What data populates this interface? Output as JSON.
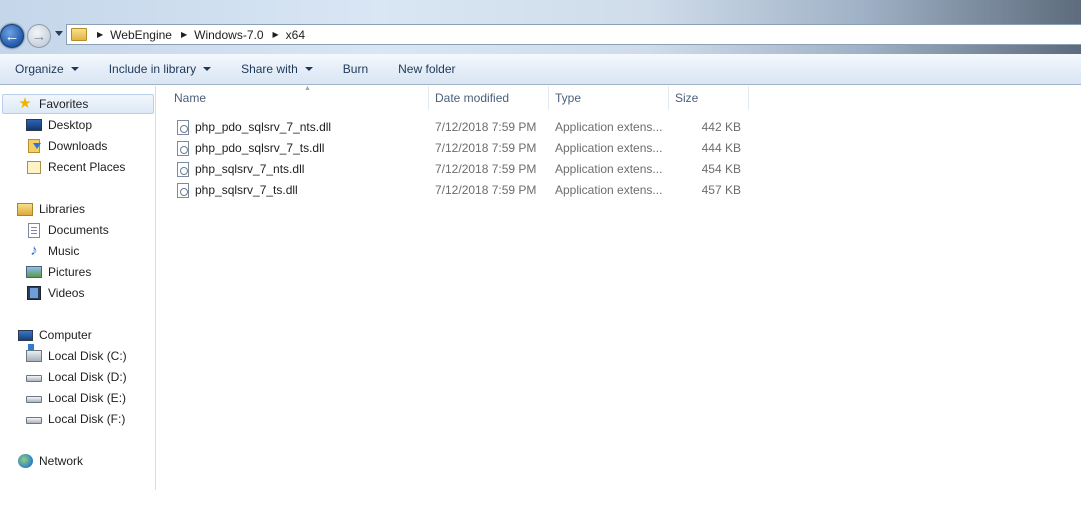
{
  "address": {
    "breadcrumbs": [
      "WebEngine",
      "Windows-7.0",
      "x64"
    ]
  },
  "toolbar": {
    "organize": "Organize",
    "include_in_library": "Include in library",
    "share_with": "Share with",
    "burn": "Burn",
    "new_folder": "New folder"
  },
  "sidebar": {
    "favorites": {
      "label": "Favorites",
      "items": [
        "Desktop",
        "Downloads",
        "Recent Places"
      ]
    },
    "libraries": {
      "label": "Libraries",
      "items": [
        "Documents",
        "Music",
        "Pictures",
        "Videos"
      ]
    },
    "computer": {
      "label": "Computer",
      "items": [
        "Local Disk (C:)",
        "Local Disk (D:)",
        "Local Disk (E:)",
        "Local Disk (F:)"
      ]
    },
    "network": {
      "label": "Network"
    }
  },
  "columns": {
    "name": "Name",
    "date_modified": "Date modified",
    "type": "Type",
    "size": "Size"
  },
  "files": [
    {
      "name": "php_pdo_sqlsrv_7_nts.dll",
      "date": "7/12/2018 7:59 PM",
      "type": "Application extens...",
      "size": "442 KB"
    },
    {
      "name": "php_pdo_sqlsrv_7_ts.dll",
      "date": "7/12/2018 7:59 PM",
      "type": "Application extens...",
      "size": "444 KB"
    },
    {
      "name": "php_sqlsrv_7_nts.dll",
      "date": "7/12/2018 7:59 PM",
      "type": "Application extens...",
      "size": "454 KB"
    },
    {
      "name": "php_sqlsrv_7_ts.dll",
      "date": "7/12/2018 7:59 PM",
      "type": "Application extens...",
      "size": "457 KB"
    }
  ],
  "colors": {
    "toolbar_text": "#1e395b",
    "header_text": "#4c607a",
    "secondary_text": "#6d6d6d",
    "selection_border": "#b8d0ec"
  }
}
